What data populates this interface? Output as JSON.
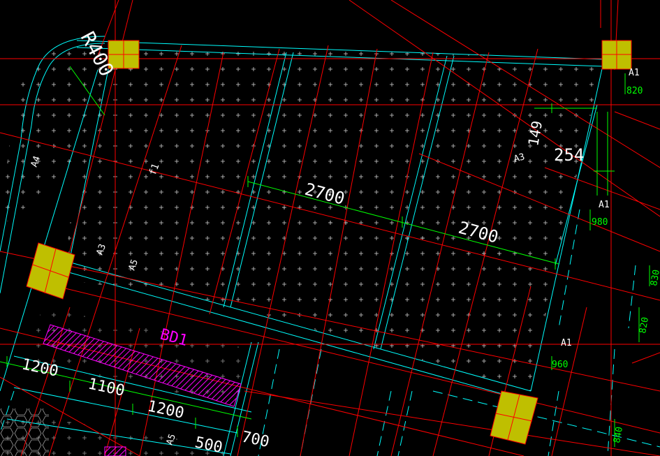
{
  "drawing": {
    "arc_label": "R400",
    "slab_label": "BD1",
    "zone_label": "f1",
    "dims": {
      "span_1": "2700",
      "span_2": "2700",
      "offset_254": "254",
      "offset_149": "149",
      "edge_1200a": "1200",
      "edge_1100": "1100",
      "edge_1200b": "1200",
      "edge_500": "500",
      "edge_700": "700"
    },
    "axis_tags": {
      "a1_top": "A1",
      "a1_mid": "A1",
      "a1_low": "A1",
      "a3_right": "A3",
      "a3_left": "A3",
      "a4_left": "A4",
      "a5_mid": "A5",
      "a5_bottom": "A5"
    },
    "green_values": {
      "v820_top": "820",
      "v980": "980",
      "v830": "830",
      "v820_right": "820",
      "v960": "960",
      "v840": "840"
    }
  },
  "colors": {
    "background": "#000000",
    "axis_red": "#ff0000",
    "slab_cyan": "#00ffff",
    "dimension_green": "#00ff00",
    "column_fill": "#bfbf00",
    "hatch_magenta": "#ff00ff",
    "text_white": "#ffffff",
    "hatch_cross": "#cccccc"
  }
}
